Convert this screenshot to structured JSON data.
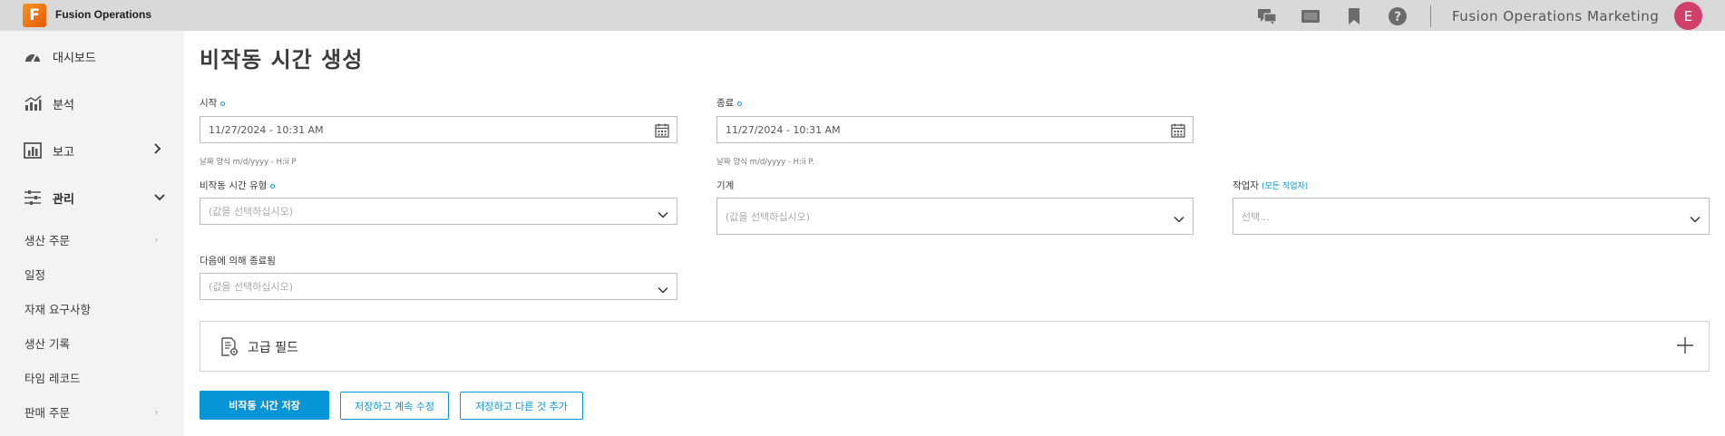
{
  "topbar": {
    "logo_letter": "F",
    "app_name": "Fusion Operations",
    "org_name": "Fusion Operations Marketing",
    "avatar_initial": "E",
    "icons": [
      "chat-icon",
      "presentation-icon",
      "bookmark-icon",
      "help-icon"
    ]
  },
  "sidebar": {
    "items": [
      {
        "label": "대시보드",
        "icon": "dashboard-icon"
      },
      {
        "label": "분석",
        "icon": "analytics-icon"
      },
      {
        "label": "보고",
        "icon": "report-icon"
      },
      {
        "label": "관리",
        "icon": "settings-sliders-icon"
      }
    ],
    "sub_items": [
      {
        "label": "생산 주문"
      },
      {
        "label": "일정"
      },
      {
        "label": "자재 요구사항"
      },
      {
        "label": "생산 기록"
      },
      {
        "label": "타임 레코드"
      },
      {
        "label": "판매 주문"
      }
    ]
  },
  "page": {
    "title": "비작동 시간 생성"
  },
  "form": {
    "start_label": "시작",
    "start_value": "11/27/2024 - 10:31 AM",
    "start_hint": "날짜 양식 m/d/yyyy - H:ii P",
    "end_label": "종료",
    "end_value": "11/27/2024 - 10:31 AM",
    "end_hint": "날짜 양식 m/d/yyyy - H:ii P.",
    "downtime_type_label": "비작동 시간 유형",
    "downtime_type_placeholder": "(값을 선택하십시오)",
    "machine_label": "기계",
    "machine_placeholder": "(값을 선택하십시오)",
    "operator_label": "작업자",
    "operator_link": "(모든 작업자)",
    "operator_placeholder": "선택...",
    "ended_by_label": "다음에 의해 종료됨",
    "ended_by_placeholder": "(값을 선택하십시오)"
  },
  "advanced": {
    "label": "고급 필드"
  },
  "buttons": {
    "save": "비작동 시간 저장",
    "save_continue": "저장하고 계속 수정",
    "save_add": "저장하고 다른 것 추가"
  },
  "colors": {
    "accent": "#0696d7",
    "avatar": "#d0406a",
    "topbar": "#d9d9d9",
    "sidebar": "#f3f3f3"
  }
}
